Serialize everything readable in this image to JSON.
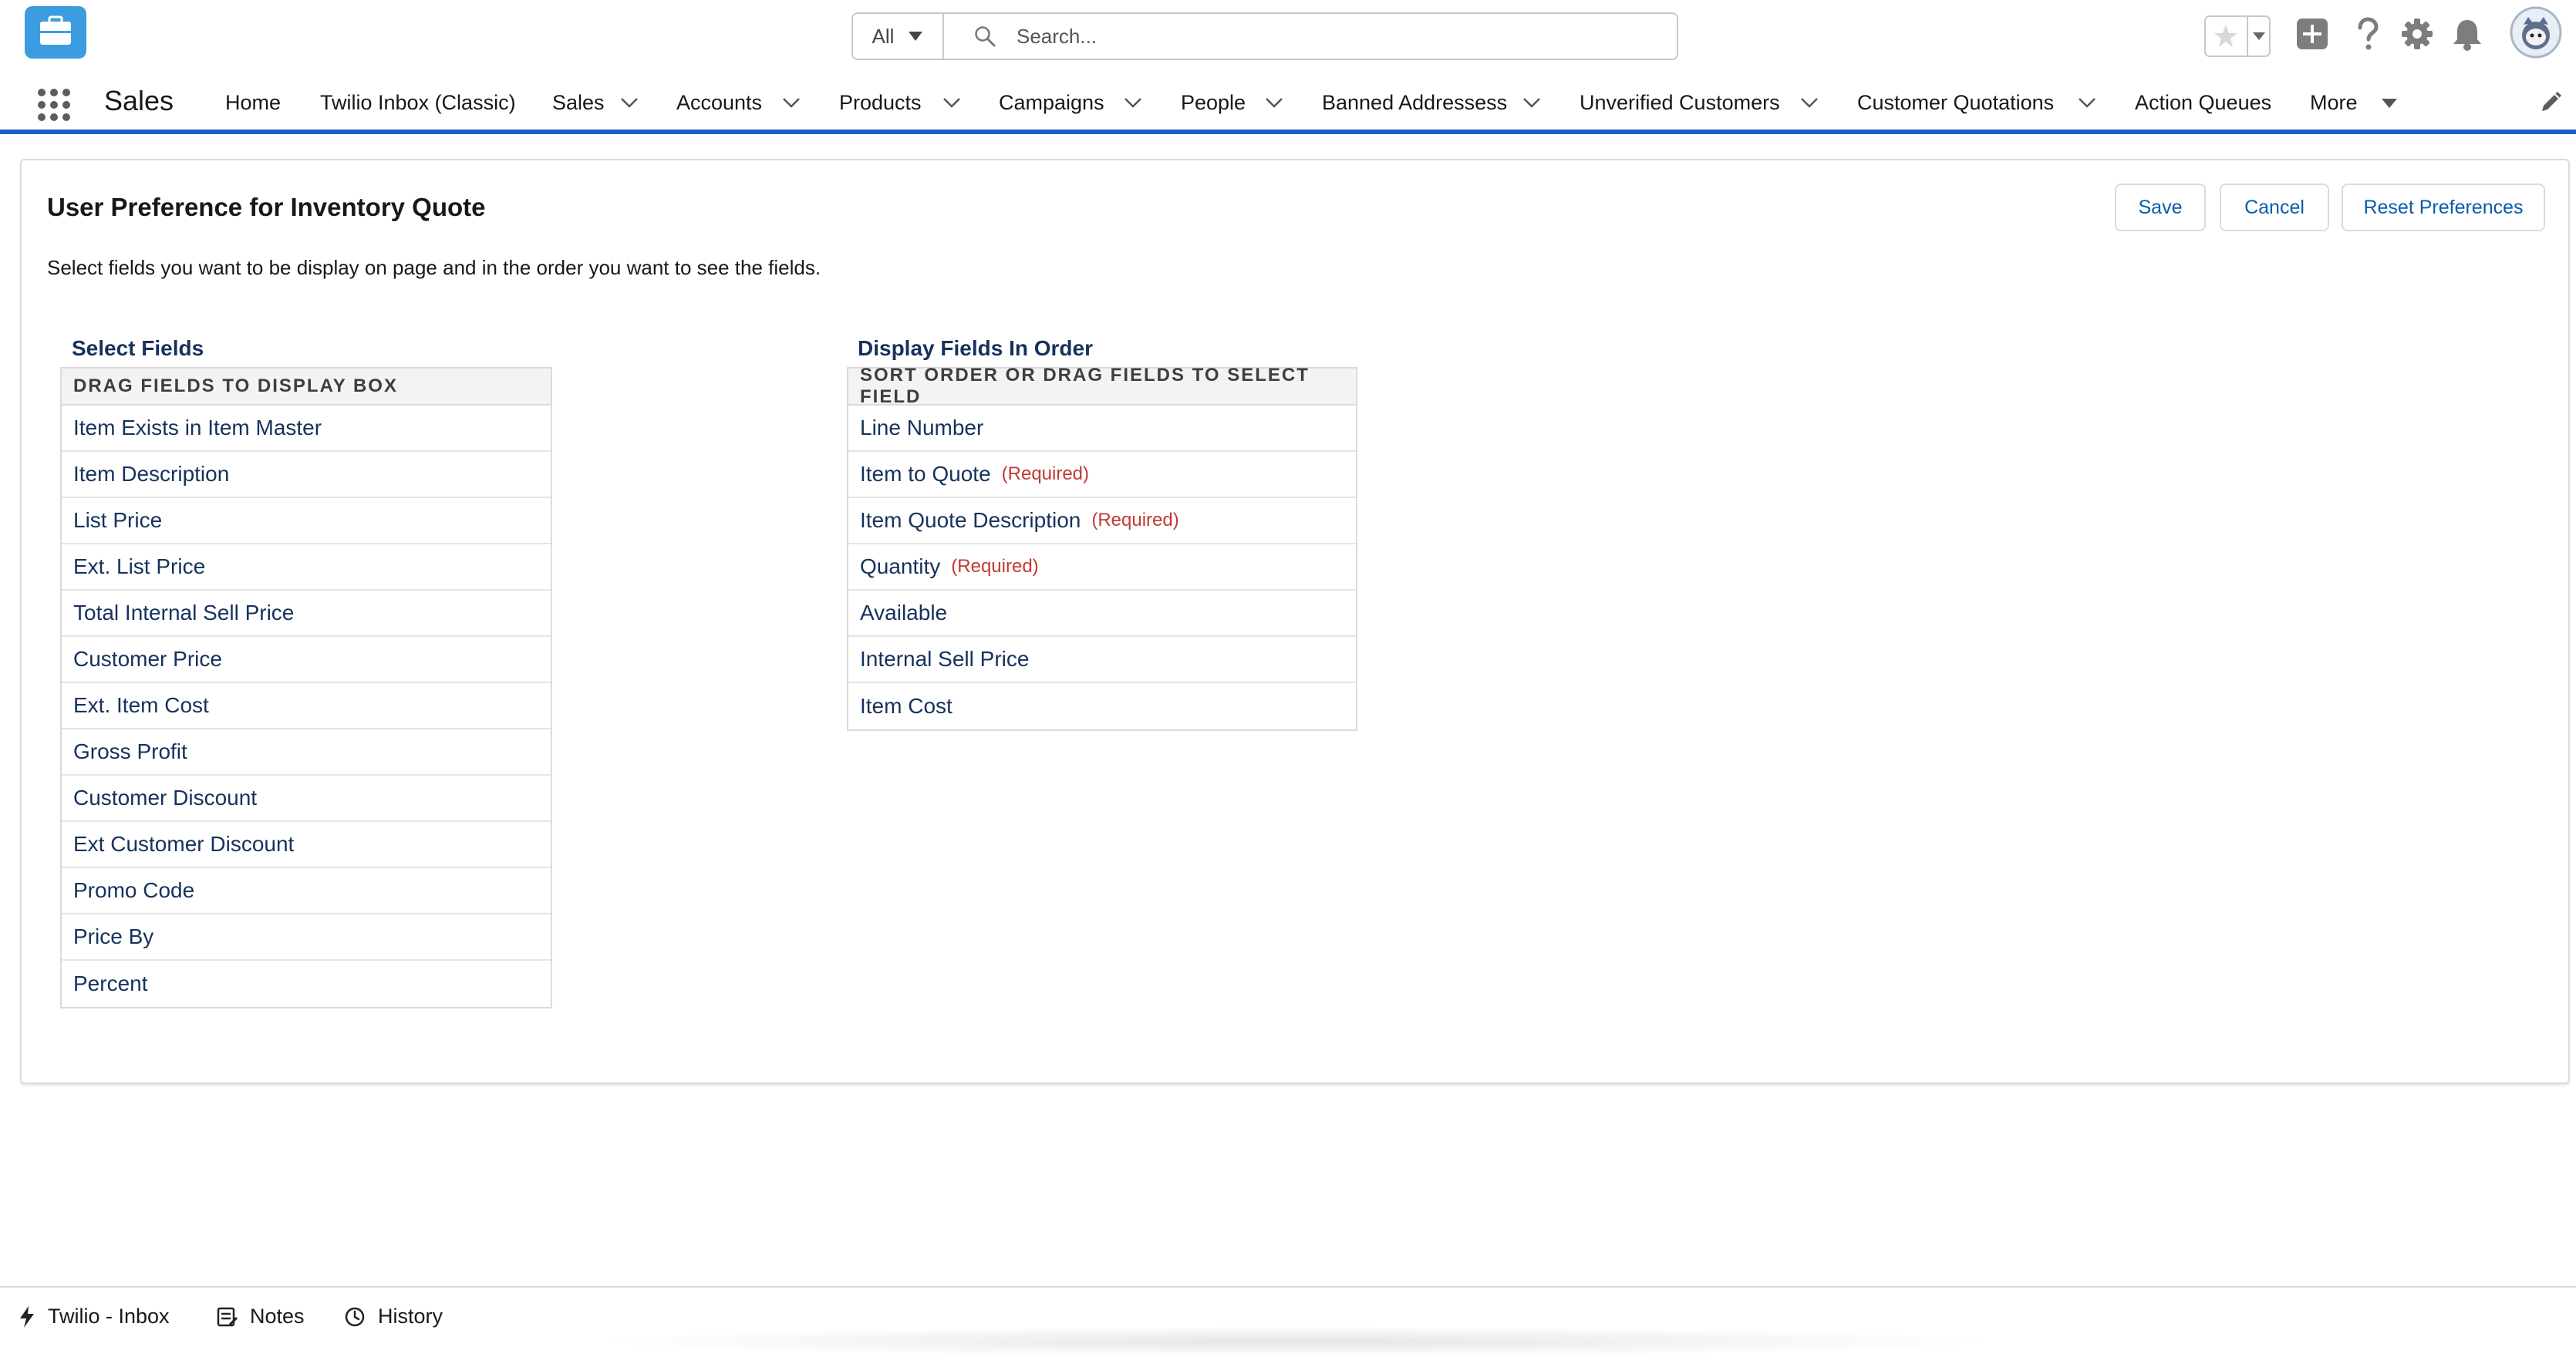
{
  "header": {
    "search_scope": "All",
    "search_placeholder": "Search..."
  },
  "nav": {
    "app_name": "Sales",
    "items": [
      {
        "label": "Home"
      },
      {
        "label": "Twilio Inbox (Classic)"
      },
      {
        "label": "Sales"
      },
      {
        "label": "Accounts"
      },
      {
        "label": "Products"
      },
      {
        "label": "Campaigns"
      },
      {
        "label": "People"
      },
      {
        "label": "Banned Addressess"
      },
      {
        "label": "Unverified Customers"
      },
      {
        "label": "Customer Quotations"
      },
      {
        "label": "Action Queues"
      },
      {
        "label": "More"
      }
    ]
  },
  "page": {
    "title": "User Preference for Inventory Quote",
    "description": "Select fields you want to be display on page and in the order you want to see the fields.",
    "buttons": {
      "save": "Save",
      "cancel": "Cancel",
      "reset": "Reset Preferences"
    }
  },
  "select_fields": {
    "label": "Select Fields",
    "header": "DRAG FIELDS TO DISPLAY BOX",
    "items": [
      "Item Exists in Item Master",
      "Item Description",
      "List Price",
      "Ext. List Price",
      "Total Internal Sell Price",
      "Customer Price",
      "Ext. Item Cost",
      "Gross Profit",
      "Customer Discount",
      "Ext Customer Discount",
      "Promo Code",
      "Price By",
      "Percent"
    ]
  },
  "display_fields": {
    "label": "Display Fields In Order",
    "header": "SORT ORDER OR DRAG FIELDS TO SELECT FIELD",
    "required_label": "(Required)",
    "items": [
      {
        "label": "Line Number",
        "required": false
      },
      {
        "label": "Item to Quote",
        "required": true
      },
      {
        "label": "Item Quote Description",
        "required": true
      },
      {
        "label": "Quantity",
        "required": true
      },
      {
        "label": "Available",
        "required": false
      },
      {
        "label": "Internal Sell Price",
        "required": false
      },
      {
        "label": "Item Cost",
        "required": false
      }
    ]
  },
  "utility": {
    "items": [
      {
        "label": "Twilio - Inbox",
        "icon": "lightning-icon"
      },
      {
        "label": "Notes",
        "icon": "notes-icon"
      },
      {
        "label": "History",
        "icon": "clock-icon"
      }
    ]
  },
  "colors": {
    "brand_blue": "#1b5fc4",
    "link_blue": "#0b5cab",
    "logo_blue": "#3b9de0",
    "required_red": "#c23934",
    "label_navy": "#16325c"
  }
}
